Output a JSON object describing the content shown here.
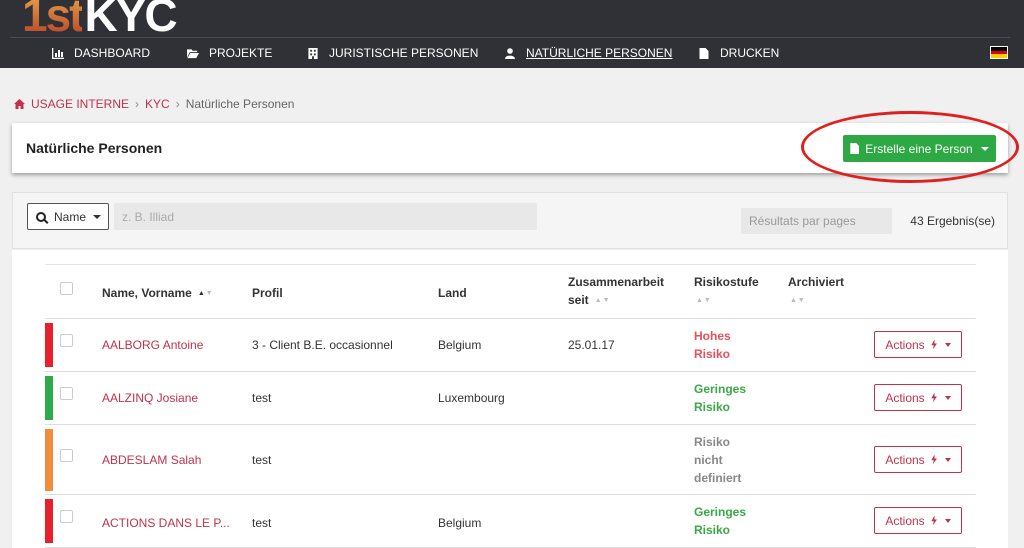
{
  "app": {
    "logo_part1": "1st",
    "logo_part2": "KYC"
  },
  "nav": {
    "items": [
      {
        "label": "DASHBOARD",
        "icon": "bar-chart-icon"
      },
      {
        "label": "PROJEKTE",
        "icon": "folder-icon"
      },
      {
        "label": "JURISTISCHE PERSONEN",
        "icon": "building-icon"
      },
      {
        "label": "NATÜRLICHE PERSONEN",
        "icon": "user-icon",
        "active": true
      },
      {
        "label": "DRUCKEN",
        "icon": "file-icon"
      }
    ],
    "language_flag": "de-flag-icon"
  },
  "breadcrumb": {
    "items": [
      "USAGE INTERNE",
      "KYC"
    ],
    "current": "Natürliche Personen"
  },
  "header": {
    "title": "Natürliche Personen",
    "create_button": "Erstelle eine Person"
  },
  "filters": {
    "field_label": "Name",
    "search_placeholder": "z. B. Illiad",
    "perpage_placeholder": "Résultats par pages",
    "result_count": "43 Ergebnis(se)"
  },
  "table": {
    "columns": {
      "name": "Name, Vorname",
      "profil": "Profil",
      "land": "Land",
      "zusammenarbeit_1": "Zusammenarbeit",
      "zusammenarbeit_2": "seit",
      "risikostufe": "Risikostufe",
      "archiviert": "Archiviert"
    },
    "action_label": "Actions",
    "rows": [
      {
        "name": "AALBORG Antoine",
        "profil": "3 - Client B.E. occasionnel",
        "land": "Belgium",
        "seit": "25.01.17",
        "risk_lines": [
          "Hohes",
          "Risiko"
        ],
        "risk_level": "high",
        "status_color": "#e8202c"
      },
      {
        "name": "AALZINQ Josiane",
        "profil": "test",
        "land": "Luxembourg",
        "seit": "",
        "risk_lines": [
          "Geringes",
          "Risiko"
        ],
        "risk_level": "low",
        "status_color": "#2eaa4a"
      },
      {
        "name": "ABDESLAM Salah",
        "profil": "test",
        "land": "",
        "seit": "",
        "risk_lines": [
          "Risiko",
          "nicht",
          "definiert"
        ],
        "risk_level": "undefined",
        "status_color": "#f28d3c"
      },
      {
        "name": "ACTIONS DANS LE P...",
        "profil": "test",
        "land": "Belgium",
        "seit": "",
        "risk_lines": [
          "Geringes",
          "Risiko"
        ],
        "risk_level": "low",
        "status_color": "#e8202c"
      }
    ]
  },
  "colors": {
    "accent": "#c0334a",
    "success": "#2ea844",
    "risk_high": "#e8505b",
    "risk_low": "#3aa845",
    "risk_undefined": "#888888",
    "annotation": "#e0201f"
  }
}
